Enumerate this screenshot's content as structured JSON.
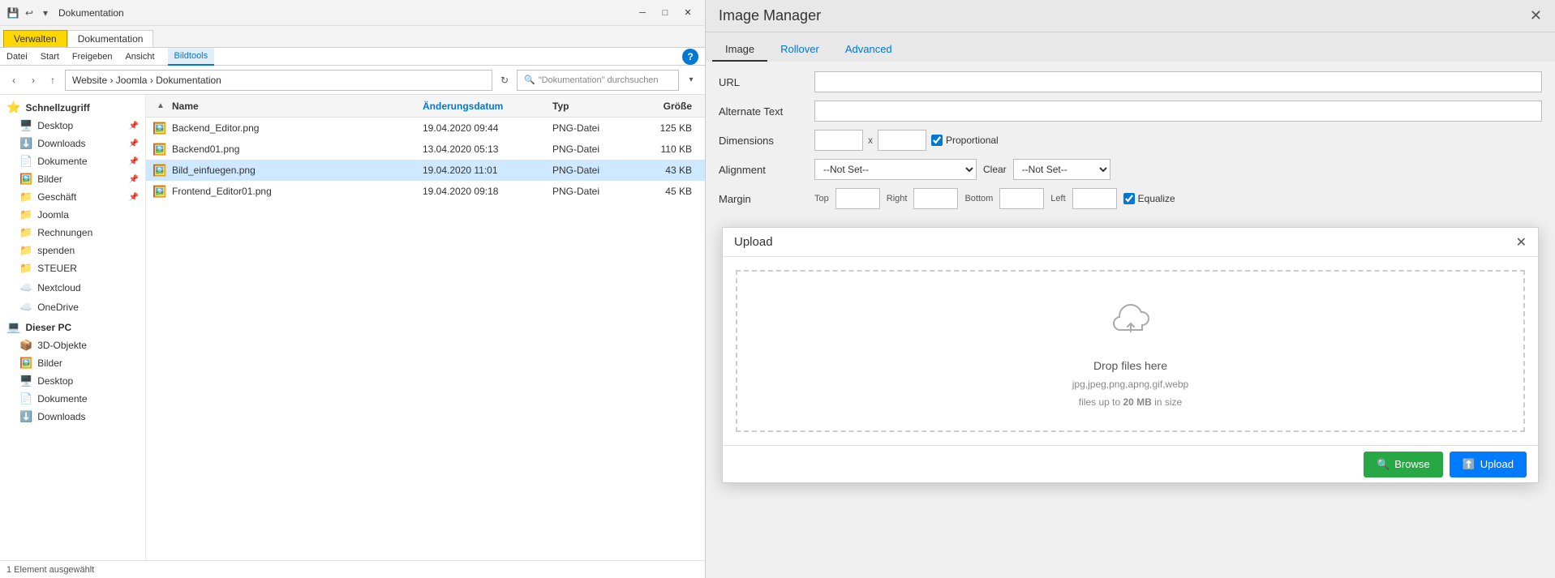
{
  "titleBar": {
    "title": "Dokumentation",
    "minimizeLabel": "─",
    "maximizeLabel": "□",
    "closeLabel": "✕"
  },
  "ribbon": {
    "tabs": [
      "Datei",
      "Start",
      "Freigeben",
      "Ansicht",
      "Bildtools"
    ],
    "activeTab": "Verwalten",
    "activeTabLabel": "Verwalten",
    "helpLabel": "?"
  },
  "addressBar": {
    "backLabel": "‹",
    "forwardLabel": "›",
    "upLabel": "↑",
    "path": "Website › Joomla › Dokumentation",
    "refreshLabel": "↻",
    "searchPlaceholder": "\"Dokumentation\" durchsuchen",
    "dropdownLabel": "▾"
  },
  "fileList": {
    "columns": {
      "name": "Name",
      "date": "Änderungsdatum",
      "type": "Typ",
      "size": "Größe"
    },
    "files": [
      {
        "name": "Backend_Editor.png",
        "date": "19.04.2020 09:44",
        "type": "PNG-Datei",
        "size": "125 KB",
        "selected": false
      },
      {
        "name": "Backend01.png",
        "date": "13.04.2020 05:13",
        "type": "PNG-Datei",
        "size": "110 KB",
        "selected": false
      },
      {
        "name": "Bild_einfuegen.png",
        "date": "19.04.2020 11:01",
        "type": "PNG-Datei",
        "size": "43 KB",
        "selected": true
      },
      {
        "name": "Frontend_Editor01.png",
        "date": "19.04.2020 09:18",
        "type": "PNG-Datei",
        "size": "45 KB",
        "selected": false
      }
    ]
  },
  "sidebar": {
    "quickAccess": {
      "label": "Schnellzugriff",
      "items": [
        {
          "name": "Desktop",
          "icon": "🖥️",
          "pinned": true
        },
        {
          "name": "Downloads",
          "icon": "⬇️",
          "pinned": true
        },
        {
          "name": "Dokumente",
          "icon": "📄",
          "pinned": true
        },
        {
          "name": "Bilder",
          "icon": "🖼️",
          "pinned": true
        },
        {
          "name": "Geschäft",
          "icon": "📁",
          "pinned": true
        },
        {
          "name": "Joomla",
          "icon": "📁",
          "pinned": false
        },
        {
          "name": "Rechnungen",
          "icon": "📁",
          "pinned": false
        },
        {
          "name": "spenden",
          "icon": "📁",
          "pinned": false
        },
        {
          "name": "STEUER",
          "icon": "📁",
          "pinned": false
        }
      ]
    },
    "nextcloud": {
      "label": "Nextcloud",
      "icon": "☁️"
    },
    "onedrive": {
      "label": "OneDrive",
      "icon": "☁️"
    },
    "thisPc": {
      "label": "Dieser PC",
      "items": [
        {
          "name": "3D-Objekte",
          "icon": "📦"
        },
        {
          "name": "Bilder",
          "icon": "🖼️"
        },
        {
          "name": "Desktop",
          "icon": "🖥️"
        },
        {
          "name": "Dokumente",
          "icon": "📄"
        },
        {
          "name": "Downloads",
          "icon": "⬇️"
        }
      ]
    }
  },
  "statusBar": {
    "text": "1 Element ausgewählt"
  },
  "imageManager": {
    "title": "Image Manager",
    "closeLabel": "✕",
    "tabs": [
      {
        "label": "Image",
        "active": true
      },
      {
        "label": "Rollover",
        "active": false
      },
      {
        "label": "Advanced",
        "active": false
      }
    ],
    "fields": {
      "url": {
        "label": "URL",
        "value": ""
      },
      "alternateText": {
        "label": "Alternate Text",
        "value": ""
      },
      "dimensions": {
        "label": "Dimensions",
        "width": "",
        "x": "x",
        "height": "",
        "proportional": true,
        "proportionalLabel": "Proportional"
      },
      "alignment": {
        "label": "Alignment",
        "value": "--Not Set--",
        "clearLabel": "Clear",
        "clearValue": "--Not Set--"
      },
      "margin": {
        "label": "Margin",
        "top": "",
        "right": "",
        "bottom": "",
        "left": "",
        "equalize": true,
        "equalizeLabel": "Equalize"
      }
    }
  },
  "uploadDialog": {
    "title": "Upload",
    "closeLabel": "✕",
    "dropText": "Drop files here",
    "types": "jpg,jpeg,png,apng,gif,webp",
    "sizeText1": "files up to ",
    "sizeHighlight": "20 MB",
    "sizeText2": " in size",
    "browseLabel": "Browse",
    "uploadLabel": "Upload"
  }
}
